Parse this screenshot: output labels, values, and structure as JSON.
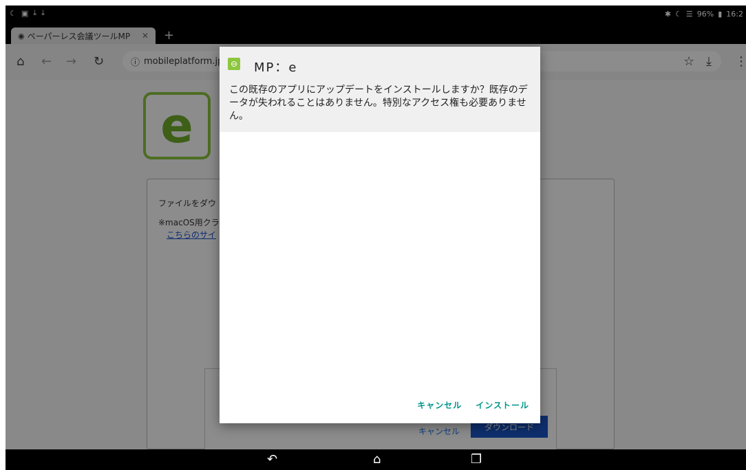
{
  "status_bar": {
    "battery": "96%",
    "time": "16:2"
  },
  "browser": {
    "tab_title": "ペーパーレス会議ツールMP",
    "new_tab": "+",
    "url": "mobileplatform.jp"
  },
  "page": {
    "logo_letter": "e",
    "download_text": "ファイルをダウ",
    "macos_note": "※macOS用クラ",
    "site_link": "こちらのサイ",
    "bg_cancel": "キャンセル",
    "bg_download": "ダウンロード"
  },
  "dialog": {
    "app_name": "MP：e",
    "message": "この既存のアプリにアップデートをインストールしますか？既存のデータが失われることはありません。特別なアクセス権も必要ありません。",
    "cancel_label": "キャンセル",
    "install_label": "インストール"
  },
  "colors": {
    "accent": "#009688",
    "brand": "#8dc63f"
  }
}
